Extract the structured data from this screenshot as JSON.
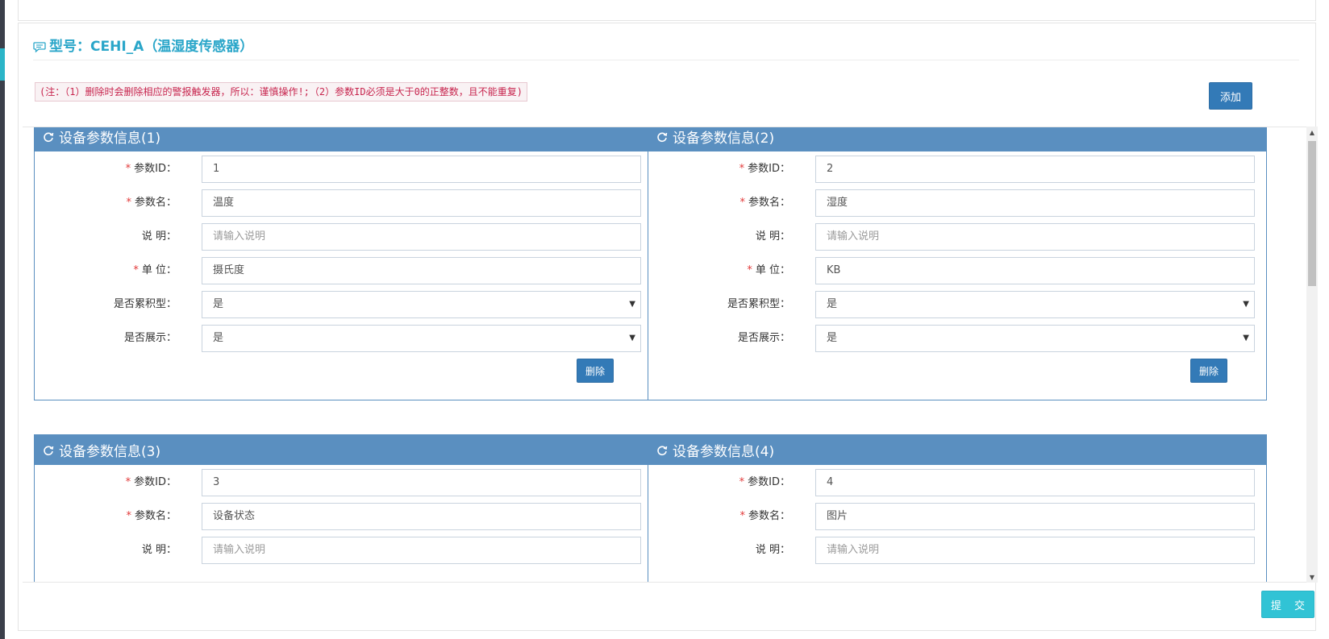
{
  "header": {
    "model_prefix": "型号：",
    "model_name": "CEHI_A",
    "model_desc": "（温湿度传感器）"
  },
  "note": "(注：（1）删除时会删除相应的警报触发器，所以：谨慎操作!;（2）参数ID必须是大于0的正整数，且不能重复)",
  "toolbar": {
    "add_label": "添加",
    "submit_label": "提 交"
  },
  "labels": {
    "param_id": "参数ID：",
    "param_name": "参数名：",
    "desc": "说 明：",
    "unit": "单 位：",
    "cumulative": "是否累积型：",
    "display": "是否展示：",
    "delete": "删除",
    "desc_placeholder": "请输入说明",
    "required_mark": "*"
  },
  "cards": [
    {
      "title": "设备参数信息(1)",
      "param_id": "1",
      "param_name": "温度",
      "desc": "",
      "unit": "摄氏度",
      "cumulative": "是",
      "display": "是"
    },
    {
      "title": "设备参数信息(2)",
      "param_id": "2",
      "param_name": "湿度",
      "desc": "",
      "unit": "KB",
      "cumulative": "是",
      "display": "是"
    },
    {
      "title": "设备参数信息(3)",
      "param_id": "3",
      "param_name": "设备状态",
      "desc": ""
    },
    {
      "title": "设备参数信息(4)",
      "param_id": "4",
      "param_name": "图片",
      "desc": ""
    }
  ],
  "colors": {
    "accent": "#2aa6c9",
    "card_header": "#5a8fc0",
    "primary_button": "#337ab7",
    "submit_button": "#31c3d5",
    "required": "#e23a3a"
  }
}
